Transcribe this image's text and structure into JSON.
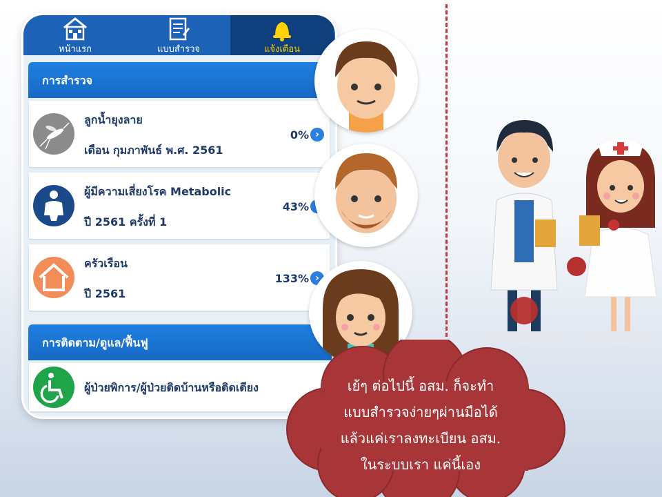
{
  "tabs": [
    {
      "label": "หน้าแรก",
      "icon": "house-icon"
    },
    {
      "label": "แบบสำรวจ",
      "icon": "clipboard-icon"
    },
    {
      "label": "แจ้งเตือน",
      "icon": "bell-icon"
    }
  ],
  "survey_section": {
    "title": "การสำรวจ",
    "items": [
      {
        "title": "ลูกน้ำยุงลาย",
        "subtitle": "เดือน กุมภาพันธ์ พ.ศ. 2561",
        "percent": "0%",
        "icon": "mosquito-icon"
      },
      {
        "title": "ผู้มีความเสี่ยงโรค Metabolic",
        "subtitle": "ปี 2561 ครั้งที่ 1",
        "percent": "43%",
        "icon": "person-icon"
      },
      {
        "title": "ครัวเรือน",
        "subtitle": "ปี 2561",
        "percent": "133%",
        "icon": "home-icon"
      }
    ]
  },
  "followup_section": {
    "title": "การติดตาม/ดูแล/ฟื้นฟู",
    "items": [
      {
        "title": "ผู้ป่วยพิการ/ผู้ป่วยติดบ้านหรือติดเตียง",
        "icon": "wheelchair-icon"
      }
    ]
  },
  "speech_bubble": {
    "lines": [
      "เย้ๆ ต่อไปนี้ อสม. ก็จะทำ",
      "แบบสำรวจง่ายๆผ่านมือได้",
      "แล้วแค่เราลงทะเบียน อสม.",
      "ในระบบเรา แค่นี้เอง"
    ]
  },
  "colors": {
    "tab_bar": "#1c63b7",
    "tab_active": "#0f3f7c",
    "section_header": "#1e7fe0",
    "text_dark": "#203a68",
    "cloud": "#a83639",
    "divider": "#c8373b"
  }
}
